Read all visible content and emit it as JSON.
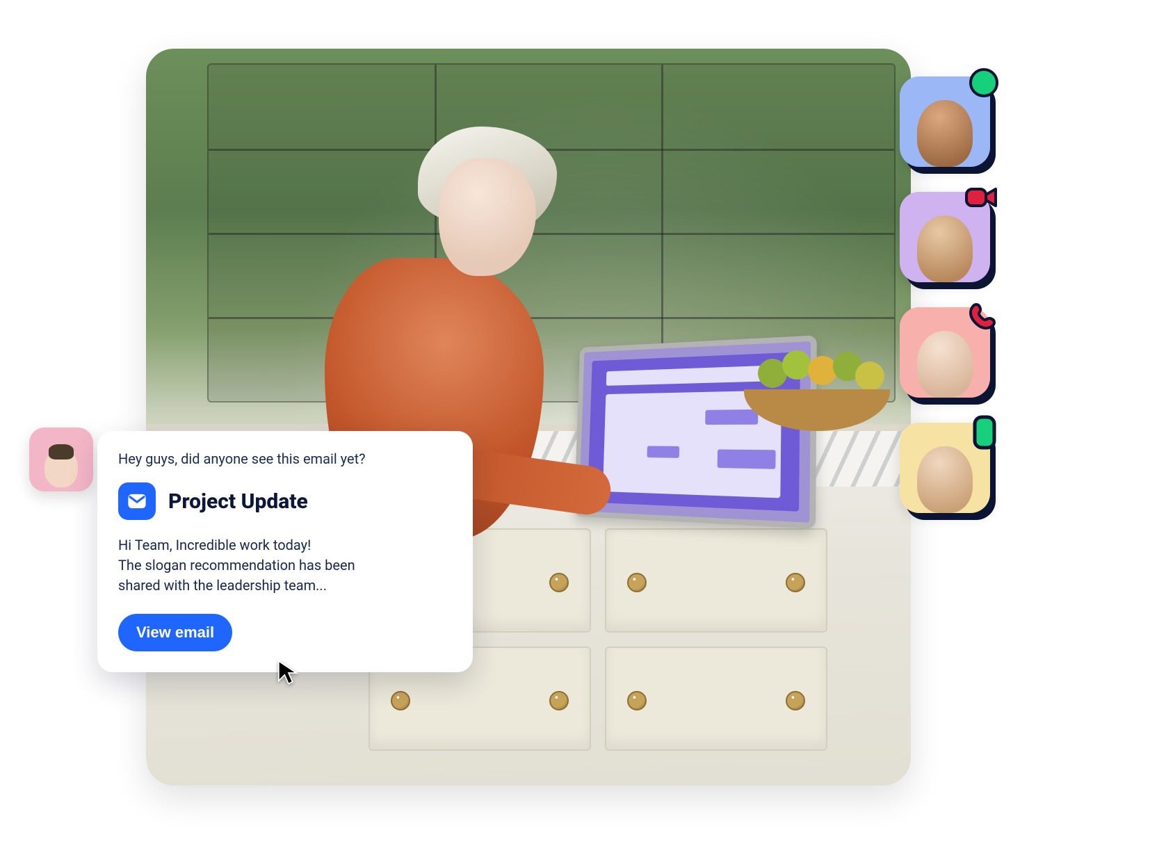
{
  "card": {
    "intro": "Hey guys, did anyone see this email yet?",
    "title": "Project Update",
    "body": "Hi Team, Incredible work today!\nThe slogan recommendation has been\nshared with the leadership team...",
    "button": "View email"
  },
  "avatars": {
    "sender": {
      "name": "sender-avatar",
      "bg": "#f3b6c7"
    },
    "rail": [
      {
        "name": "contact-1",
        "bg": "#9bb7f5",
        "status": "online"
      },
      {
        "name": "contact-2",
        "bg": "#cfb2f0",
        "status": "video"
      },
      {
        "name": "contact-3",
        "bg": "#f7b0ac",
        "status": "call"
      },
      {
        "name": "contact-4",
        "bg": "#f6e3a3",
        "status": "mobile"
      }
    ]
  },
  "colors": {
    "primary": "#1e66ff",
    "shadow": "#0b1533",
    "status_green": "#17d07c",
    "status_red": "#e0203f"
  }
}
